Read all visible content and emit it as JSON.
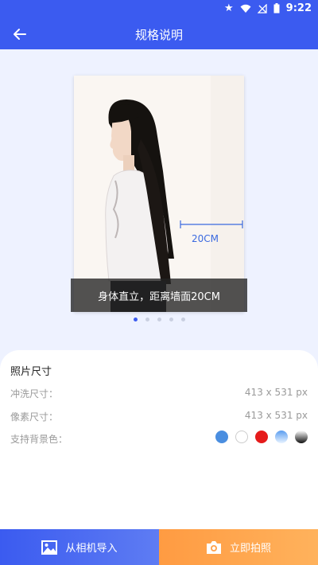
{
  "status": {
    "time": "9:22"
  },
  "header": {
    "title": "规格说明"
  },
  "carousel": {
    "distance_label": "20CM",
    "caption": "身体直立，距离墙面20CM",
    "page_count": 5,
    "active_index": 0
  },
  "spec": {
    "title": "照片尺寸",
    "rows": [
      {
        "label": "冲洗尺寸：",
        "value": "413 x 531 px"
      },
      {
        "label": "像素尺寸：",
        "value": "413 x 531 px"
      }
    ],
    "bg_label": "支持背景色：",
    "bg_colors": [
      {
        "name": "blue",
        "color": "#4a8ee0"
      },
      {
        "name": "white",
        "color": "#ffffff"
      },
      {
        "name": "red",
        "color": "#e51b1b"
      },
      {
        "name": "light-blue-gradient",
        "color": "#bfe0ff"
      },
      {
        "name": "black-gradient",
        "color": "#222222"
      }
    ]
  },
  "actions": {
    "import_label": "从相机导入",
    "import_icon": "image-icon",
    "shoot_label": "立即拍照",
    "shoot_icon": "camera-icon"
  },
  "colors": {
    "primary": "#3b5bf0",
    "accent": "#ff9b42"
  }
}
